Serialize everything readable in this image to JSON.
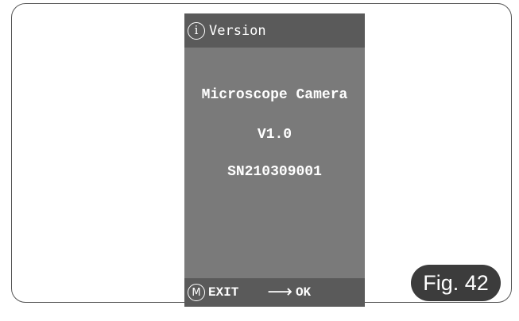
{
  "screen": {
    "header": {
      "icon": "info-icon",
      "icon_glyph": "i",
      "title": "Version"
    },
    "content": {
      "product_name": "Microscope Camera",
      "version": "V1.0",
      "serial_number": "SN210309001"
    },
    "footer": {
      "m_icon_glyph": "M",
      "exit_label": "EXIT",
      "arrow_glyph": "⟶",
      "ok_label": "OK"
    },
    "colors": {
      "header_bg": "#5a5a5a",
      "body_bg": "#7a7a7a",
      "text": "#ffffff"
    }
  },
  "figure_label": "Fig. 42"
}
